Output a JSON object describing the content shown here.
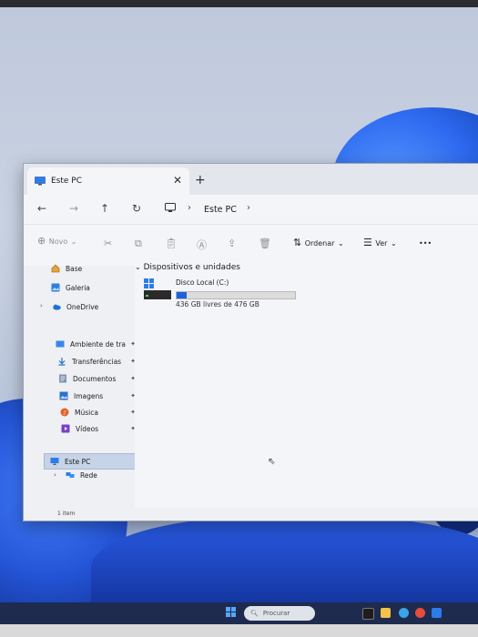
{
  "window": {
    "tab_title": "Este PC",
    "tab_close": "✕",
    "new_tab": "+",
    "address": "Este PC"
  },
  "nav": {
    "back": "←",
    "forward": "→",
    "up": "↑",
    "refresh": "↻"
  },
  "toolbar": {
    "new_label": "Novo",
    "sort_label": "Ordenar",
    "view_label": "Ver",
    "more_label": "•••"
  },
  "sidebar": {
    "items": [
      {
        "label": "Base",
        "icon": "home-icon"
      },
      {
        "label": "Galeria",
        "icon": "gallery-icon"
      },
      {
        "label": "OneDrive",
        "icon": "cloud-icon"
      },
      {
        "label": "Ambiente de tra",
        "icon": "desktop-icon"
      },
      {
        "label": "Transferências",
        "icon": "download-icon"
      },
      {
        "label": "Documentos",
        "icon": "document-icon"
      },
      {
        "label": "Imagens",
        "icon": "image-icon"
      },
      {
        "label": "Música",
        "icon": "music-icon"
      },
      {
        "label": "Vídeos",
        "icon": "video-icon"
      },
      {
        "label": "Este PC",
        "icon": "pc-icon"
      },
      {
        "label": "Rede",
        "icon": "network-icon"
      }
    ]
  },
  "content": {
    "group_header": "Dispositivos e unidades",
    "drive": {
      "name": "Disco Local (C:)",
      "free_text": "436 GB livres de 476 GB",
      "used_fraction": 0.084
    }
  },
  "status": {
    "item_count": "1 item"
  },
  "taskbar": {
    "search_placeholder": "Procurar"
  },
  "colors": {
    "accent": "#1a63d8",
    "selection": "#c7d3e6"
  }
}
